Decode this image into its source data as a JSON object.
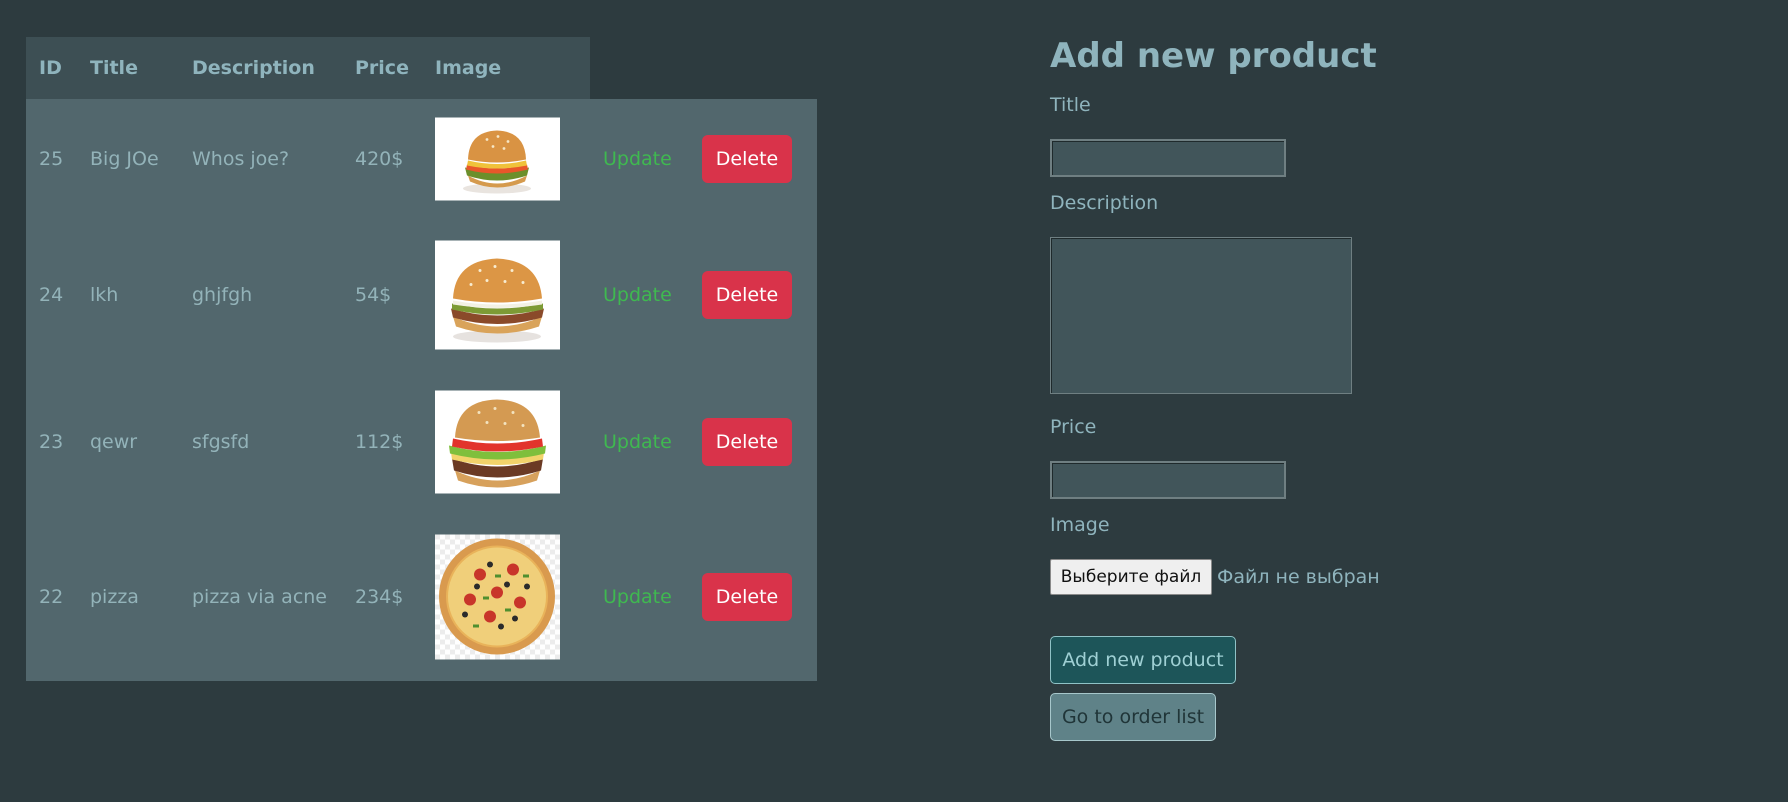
{
  "table": {
    "headers": {
      "id": "ID",
      "title": "Title",
      "description": "Description",
      "price": "Price",
      "image": "Image"
    },
    "rows": [
      {
        "id": "25",
        "title": "Big JOe",
        "description": "Whos joe?",
        "price": "420$",
        "image_icon": "burger-image",
        "update_label": "Update",
        "delete_label": "Delete"
      },
      {
        "id": "24",
        "title": "lkh",
        "description": "ghjfgh",
        "price": "54$",
        "image_icon": "burger-image",
        "update_label": "Update",
        "delete_label": "Delete"
      },
      {
        "id": "23",
        "title": "qewr",
        "description": "sfgsfd",
        "price": "112$",
        "image_icon": "burger-image",
        "update_label": "Update",
        "delete_label": "Delete"
      },
      {
        "id": "22",
        "title": "pizza",
        "description": "pizza via acne",
        "price": "234$",
        "image_icon": "pizza-image",
        "update_label": "Update",
        "delete_label": "Delete"
      }
    ]
  },
  "form": {
    "heading": "Add new product",
    "title_label": "Title",
    "title_value": "",
    "description_label": "Description",
    "description_value": "",
    "price_label": "Price",
    "price_value": "",
    "image_label": "Image",
    "file_button_label": "Выберите файл",
    "file_status": "Файл не выбран",
    "submit_label": "Add new product",
    "order_list_label": "Go to order list"
  },
  "colors": {
    "background": "#2d3b3f",
    "table_header": "#3d4f54",
    "table_body": "#52676d",
    "text": "#8fb4bd",
    "update_link": "#3fb950",
    "delete_button": "#d9334a",
    "submit_button": "#1d5559",
    "order_button": "#5f8288"
  }
}
